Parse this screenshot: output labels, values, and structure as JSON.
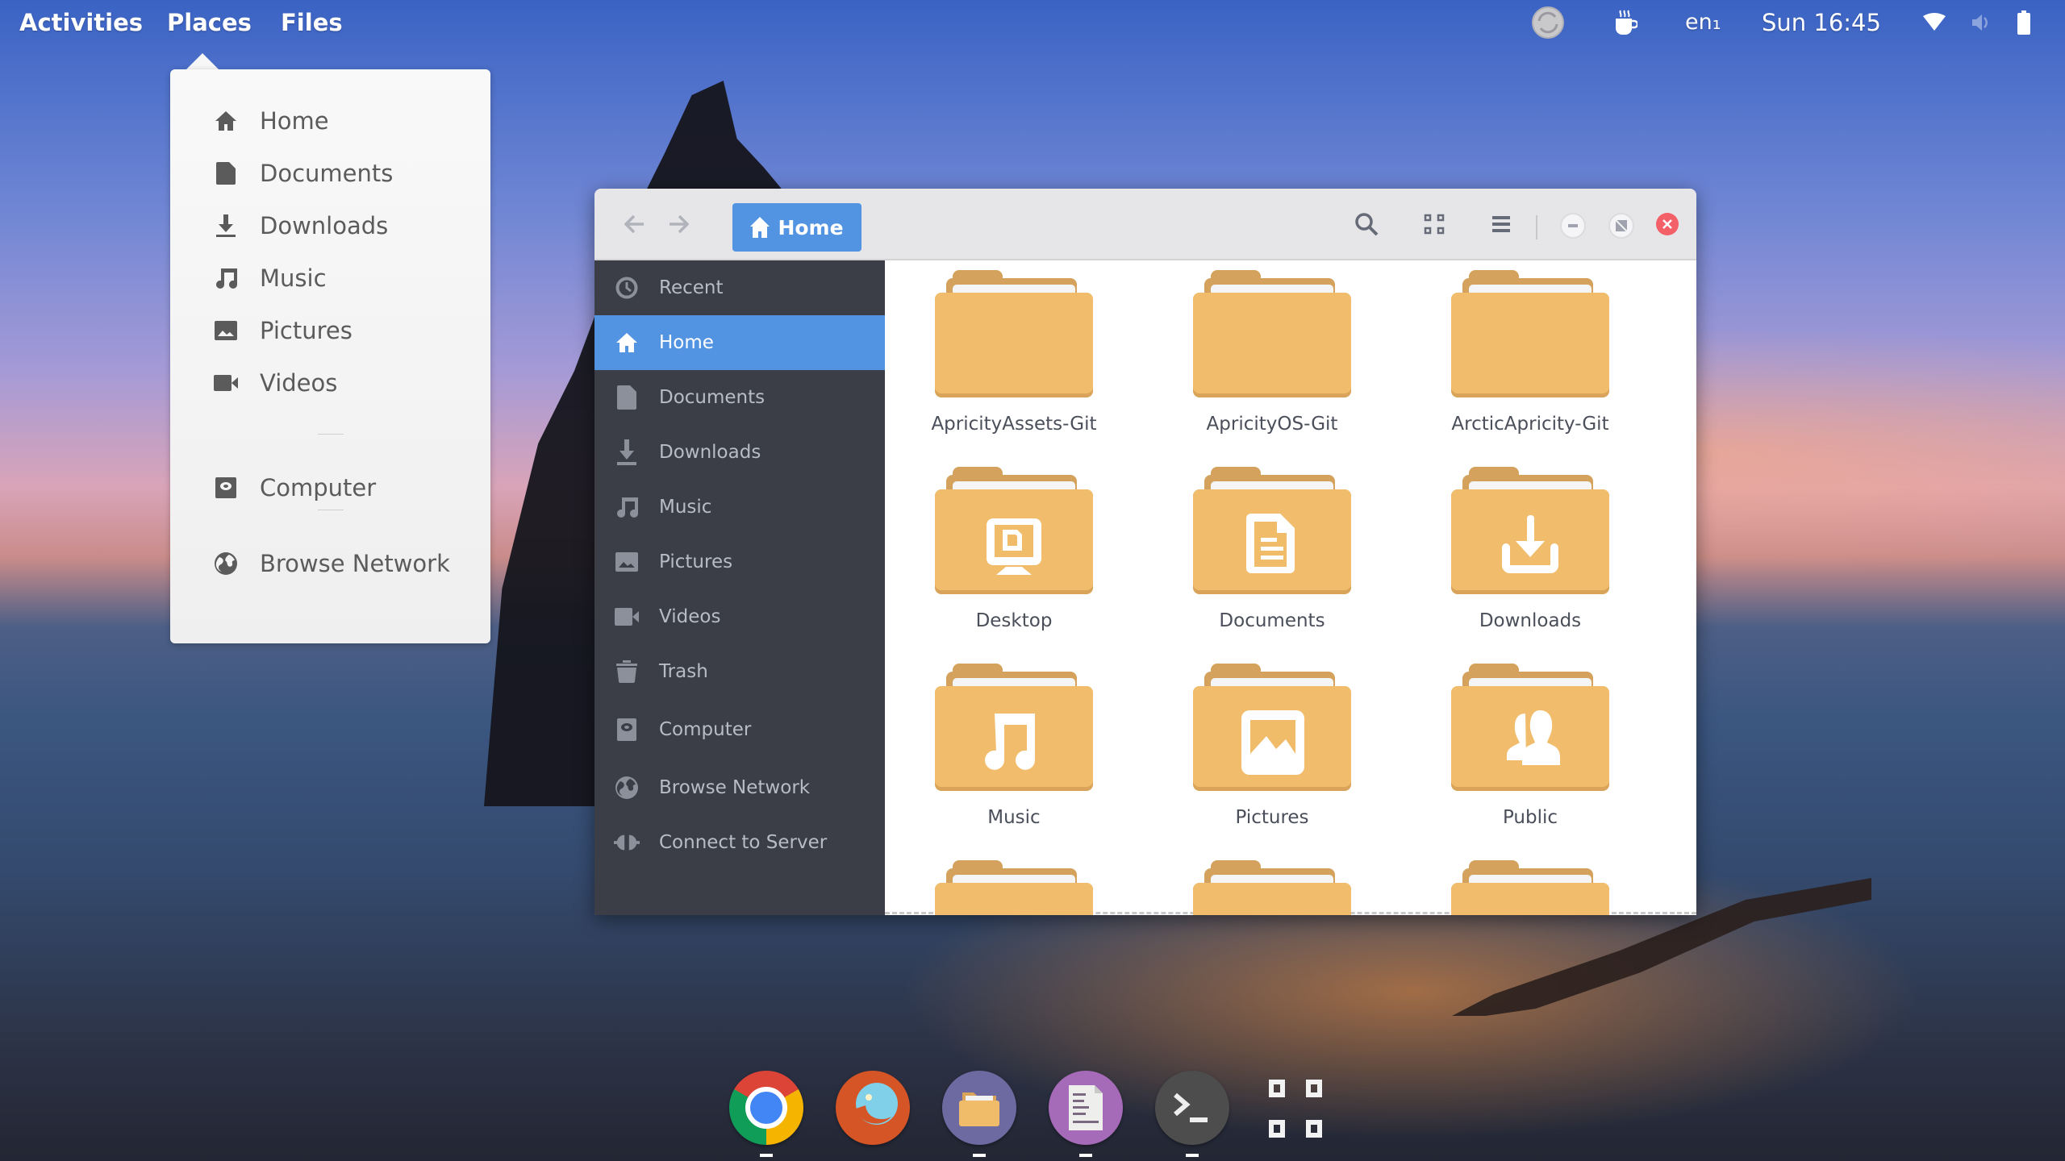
{
  "topbar": {
    "activities": "Activities",
    "places": "Places",
    "files": "Files",
    "keyboard_layout": "en₁",
    "clock": "Sun 16:45",
    "tray_icons": [
      "sync-icon",
      "coffee-cup-icon",
      "wifi-icon",
      "volume-muted-icon",
      "battery-icon"
    ]
  },
  "places_menu": {
    "items": [
      {
        "label": "Home",
        "icon": "home-icon"
      },
      {
        "label": "Documents",
        "icon": "document-icon"
      },
      {
        "label": "Downloads",
        "icon": "download-icon"
      },
      {
        "label": "Music",
        "icon": "music-icon"
      },
      {
        "label": "Pictures",
        "icon": "picture-icon"
      },
      {
        "label": "Videos",
        "icon": "video-camera-icon"
      },
      {
        "label": "Computer",
        "icon": "drive-icon"
      },
      {
        "label": "Browse Network",
        "icon": "globe-icon"
      }
    ]
  },
  "file_manager": {
    "path_button": "Home",
    "accent_color": "#5294e2",
    "sidebar": [
      {
        "label": "Recent",
        "icon": "clock-icon"
      },
      {
        "label": "Home",
        "icon": "home-icon",
        "active": true
      },
      {
        "label": "Documents",
        "icon": "document-icon"
      },
      {
        "label": "Downloads",
        "icon": "download-icon"
      },
      {
        "label": "Music",
        "icon": "music-icon"
      },
      {
        "label": "Pictures",
        "icon": "picture-icon"
      },
      {
        "label": "Videos",
        "icon": "video-camera-icon"
      },
      {
        "label": "Trash",
        "icon": "trash-icon"
      },
      {
        "label": "Computer",
        "icon": "drive-icon"
      },
      {
        "label": "Browse Network",
        "icon": "globe-icon"
      },
      {
        "label": "Connect to Server",
        "icon": "server-connect-icon"
      }
    ],
    "files": [
      {
        "name": "ApricityAssets-Git",
        "emblem": "none"
      },
      {
        "name": "ApricityOS-Git",
        "emblem": "none"
      },
      {
        "name": "ArcticApricity-Git",
        "emblem": "none"
      },
      {
        "name": "Desktop",
        "emblem": "desktop"
      },
      {
        "name": "Documents",
        "emblem": "document"
      },
      {
        "name": "Downloads",
        "emblem": "download"
      },
      {
        "name": "Music",
        "emblem": "music"
      },
      {
        "name": "Pictures",
        "emblem": "picture"
      },
      {
        "name": "Public",
        "emblem": "people"
      },
      {
        "name": "",
        "emblem": "none"
      },
      {
        "name": "",
        "emblem": "none"
      },
      {
        "name": "",
        "emblem": "none"
      }
    ]
  },
  "dock": {
    "apps": [
      {
        "name": "Google Chrome",
        "running": true
      },
      {
        "name": "Firefox",
        "running": false
      },
      {
        "name": "Files",
        "running": true
      },
      {
        "name": "Text Editor",
        "running": true
      },
      {
        "name": "Terminal",
        "running": true
      },
      {
        "name": "Show Applications",
        "running": false
      }
    ]
  }
}
